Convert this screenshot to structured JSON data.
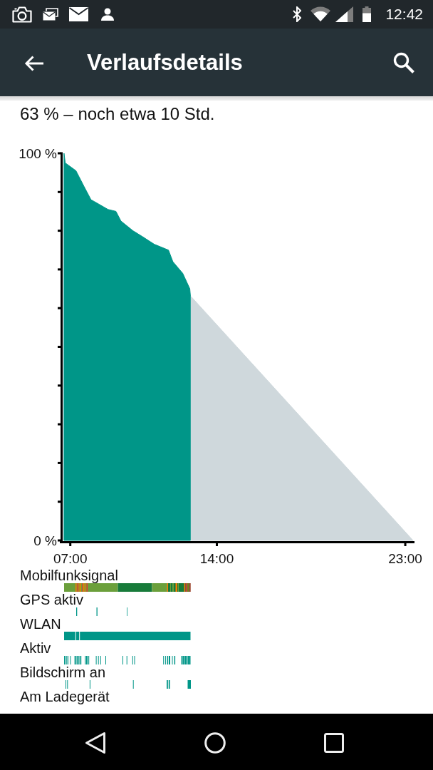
{
  "status_bar": {
    "time": "12:42"
  },
  "app_bar": {
    "title": "Verlaufsdetails"
  },
  "summary": "63 % – noch etwa 10 Std.",
  "battery_chart": {
    "chart_data": {
      "type": "area",
      "x": [
        6.7,
        6.76,
        7.27,
        7.65,
        7.99,
        8.16,
        8.8,
        9.18,
        9.42,
        9.99,
        10.44,
        11.01,
        11.69,
        11.9,
        12.37,
        12.71,
        12.74,
        12.77,
        23.37
      ],
      "series": [
        {
          "color": "#009688",
          "values": [
            100,
            97.5,
            95.5,
            91.5,
            88,
            87.5,
            85.5,
            85,
            82.5,
            80,
            78.5,
            76.5,
            75,
            72,
            69,
            65,
            63,
            null,
            null
          ]
        },
        {
          "color": "#cfd8dc",
          "values": [
            null,
            null,
            null,
            null,
            null,
            null,
            null,
            null,
            null,
            null,
            null,
            null,
            null,
            null,
            null,
            null,
            null,
            63,
            0
          ]
        }
      ],
      "xlim": [
        6.5,
        23.44
      ],
      "ylim": [
        0,
        100
      ],
      "xticks": [
        {
          "value": 7,
          "label": "07:00"
        },
        {
          "value": 14,
          "label": "14:00"
        },
        {
          "value": 23,
          "label": "23:00"
        }
      ],
      "yticks": [
        {
          "value": 0,
          "label": "0 %"
        },
        {
          "value": 100,
          "label": "100 %"
        }
      ]
    }
  },
  "tracks": [
    {
      "label": "Mobilfunksignal",
      "kind": "signal"
    },
    {
      "label": "GPS aktiv",
      "kind": "marks"
    },
    {
      "label": "WLAN",
      "kind": "band"
    },
    {
      "label": "Aktiv",
      "kind": "marks"
    },
    {
      "label": "Bildschirm an",
      "kind": "marks"
    },
    {
      "label": "Am Ladegerät",
      "kind": "empty"
    }
  ]
}
